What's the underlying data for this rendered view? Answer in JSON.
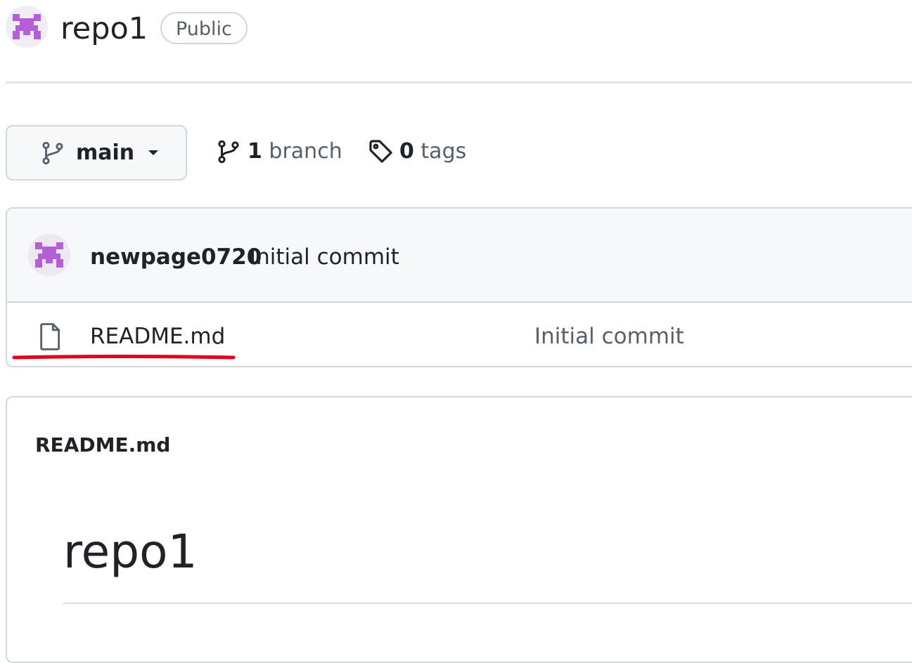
{
  "repo": {
    "name": "repo1",
    "visibility": "Public",
    "avatar_icon": "identicon-avatar-icon"
  },
  "branch_bar": {
    "current_branch": "main",
    "branch_count": "1",
    "branch_word": "branch",
    "tag_count": "0",
    "tag_word": "tags"
  },
  "latest_commit": {
    "author": "newpage0720",
    "message": "Initial commit"
  },
  "files": [
    {
      "name": "README.md",
      "commit_message": "Initial commit",
      "icon": "file-icon"
    }
  ],
  "readme": {
    "header": "README.md",
    "title": "repo1"
  },
  "colors": {
    "identicon": "#b45fd6",
    "annotation_underline": "#e0001b",
    "border": "#d0d7de",
    "muted_text": "#57606a"
  }
}
